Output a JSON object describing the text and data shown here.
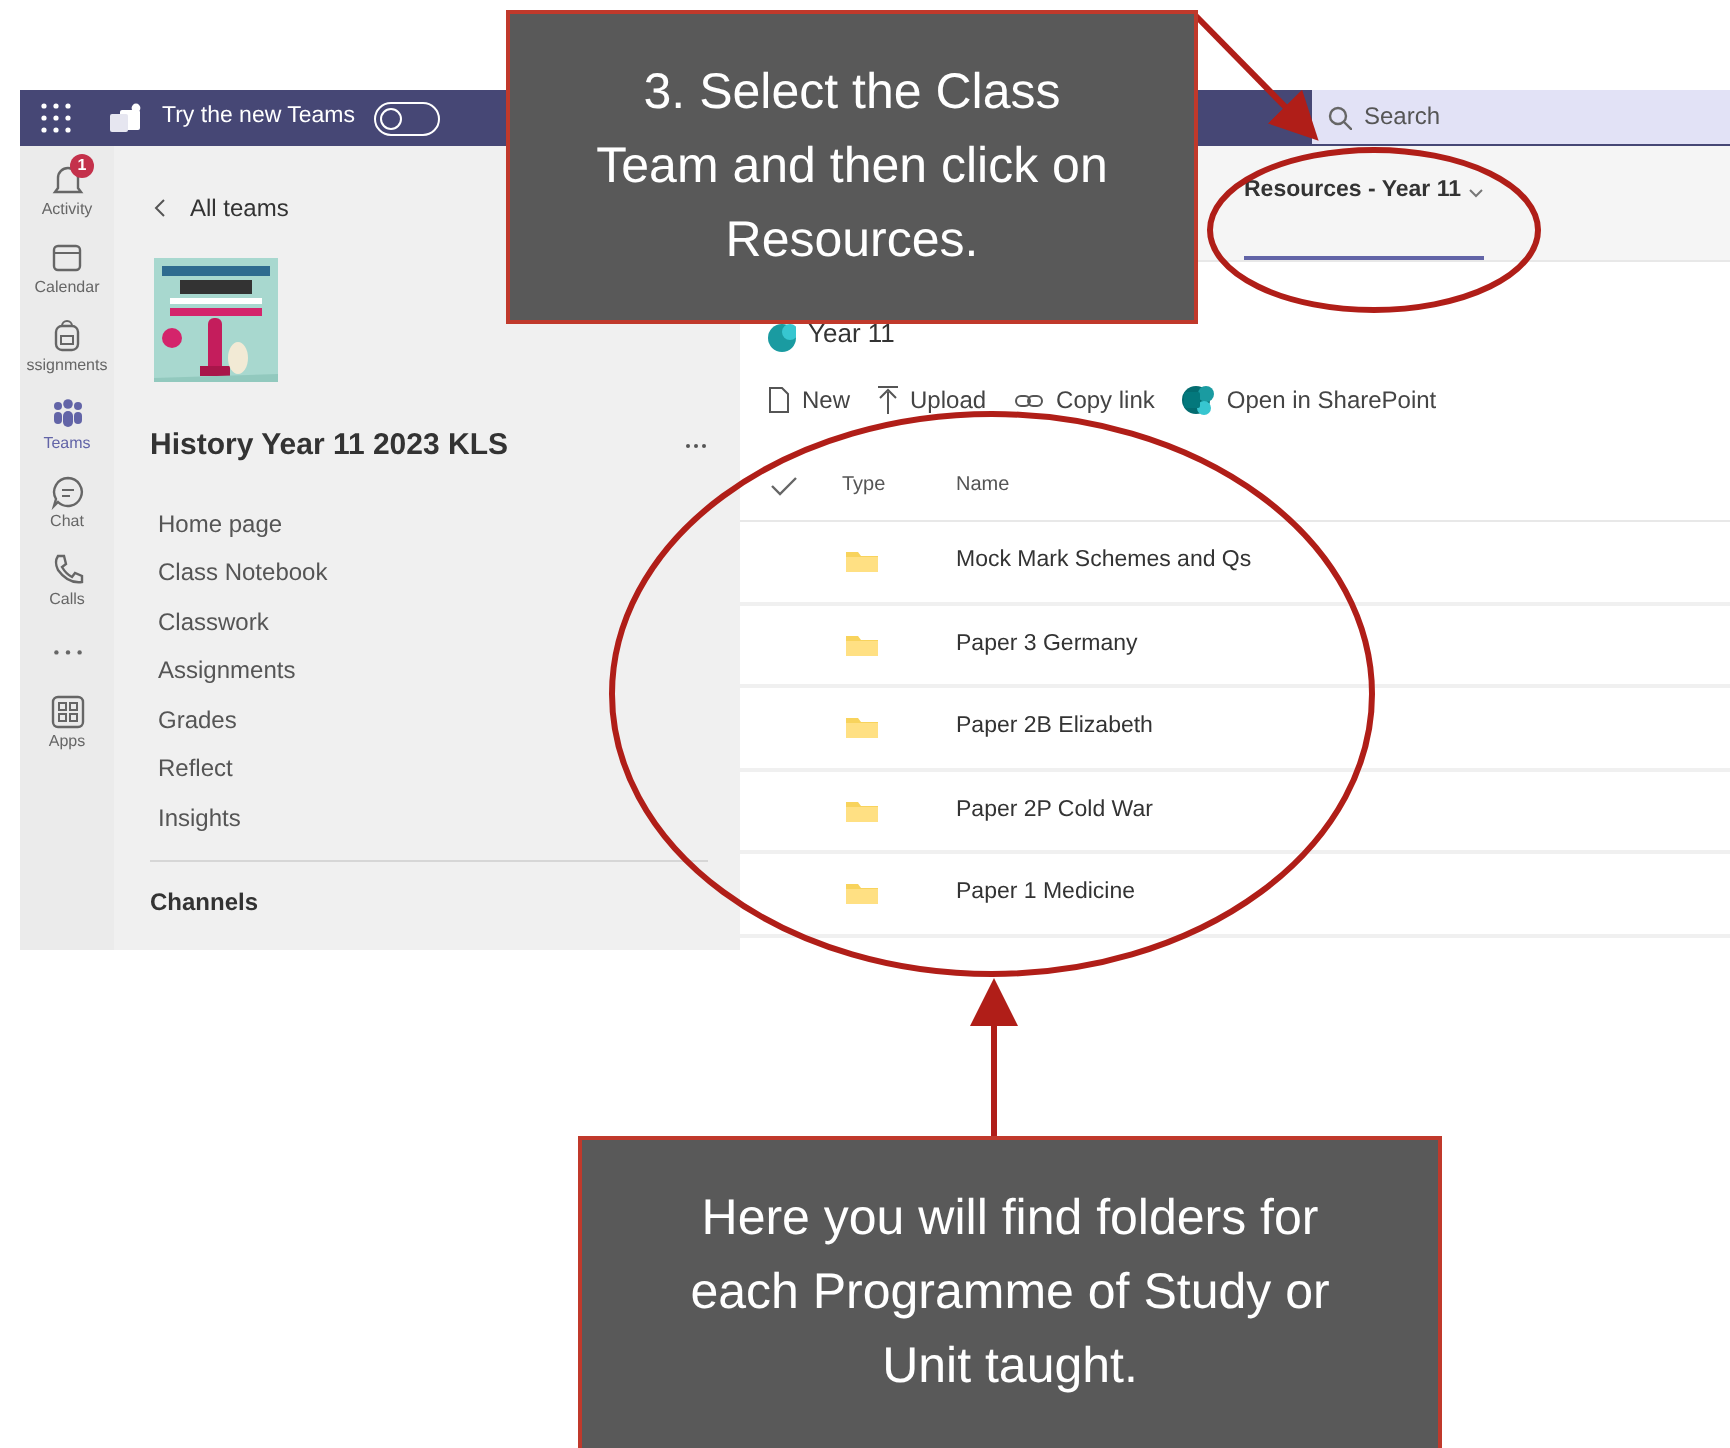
{
  "top_bar": {
    "label": "Try the new Teams",
    "toggle_on": false,
    "search_placeholder": "Search"
  },
  "rail": [
    {
      "kind": "bell",
      "label": "Activity",
      "badge": "1",
      "selected": false
    },
    {
      "kind": "calendar",
      "label": "Calendar",
      "selected": false
    },
    {
      "kind": "bag",
      "label": "ssignments",
      "selected": false
    },
    {
      "kind": "teams",
      "label": "Teams",
      "selected": true
    },
    {
      "kind": "chat",
      "label": "Chat",
      "selected": false
    },
    {
      "kind": "phone",
      "label": "Calls",
      "selected": false
    },
    {
      "kind": "more",
      "selected": false
    },
    {
      "kind": "apps",
      "label": "Apps",
      "selected": false
    }
  ],
  "sidebar": {
    "back": "All teams",
    "team_name": "History Year 11 2023 KLS",
    "items": [
      "Home page",
      "Class Notebook",
      "Classwork",
      "Assignments",
      "Grades",
      "Reflect",
      "Insights"
    ],
    "section": "Channels"
  },
  "tabs": [
    {
      "label": "Resources - Year 11",
      "selected": true
    }
  ],
  "library": {
    "title": "Year 11",
    "actions": [
      {
        "kind": "new",
        "label": "New"
      },
      {
        "kind": "upload",
        "label": "Upload"
      },
      {
        "kind": "link",
        "label": "Copy link"
      },
      {
        "kind": "sharepoint",
        "label": "Open in SharePoint"
      }
    ],
    "columns": [
      "Type",
      "Name"
    ],
    "rows": [
      {
        "name": "Mock Mark Schemes and Qs"
      },
      {
        "name": "Paper 3 Germany"
      },
      {
        "name": "Paper 2B Elizabeth"
      },
      {
        "name": "Paper 2P Cold War"
      },
      {
        "name": "Paper 1 Medicine"
      }
    ]
  },
  "callouts": [
    {
      "text": "3. Select the Class Team and then click on Resources."
    },
    {
      "text": "Here you will find folders for each Programme of Study or Unit taught."
    }
  ]
}
